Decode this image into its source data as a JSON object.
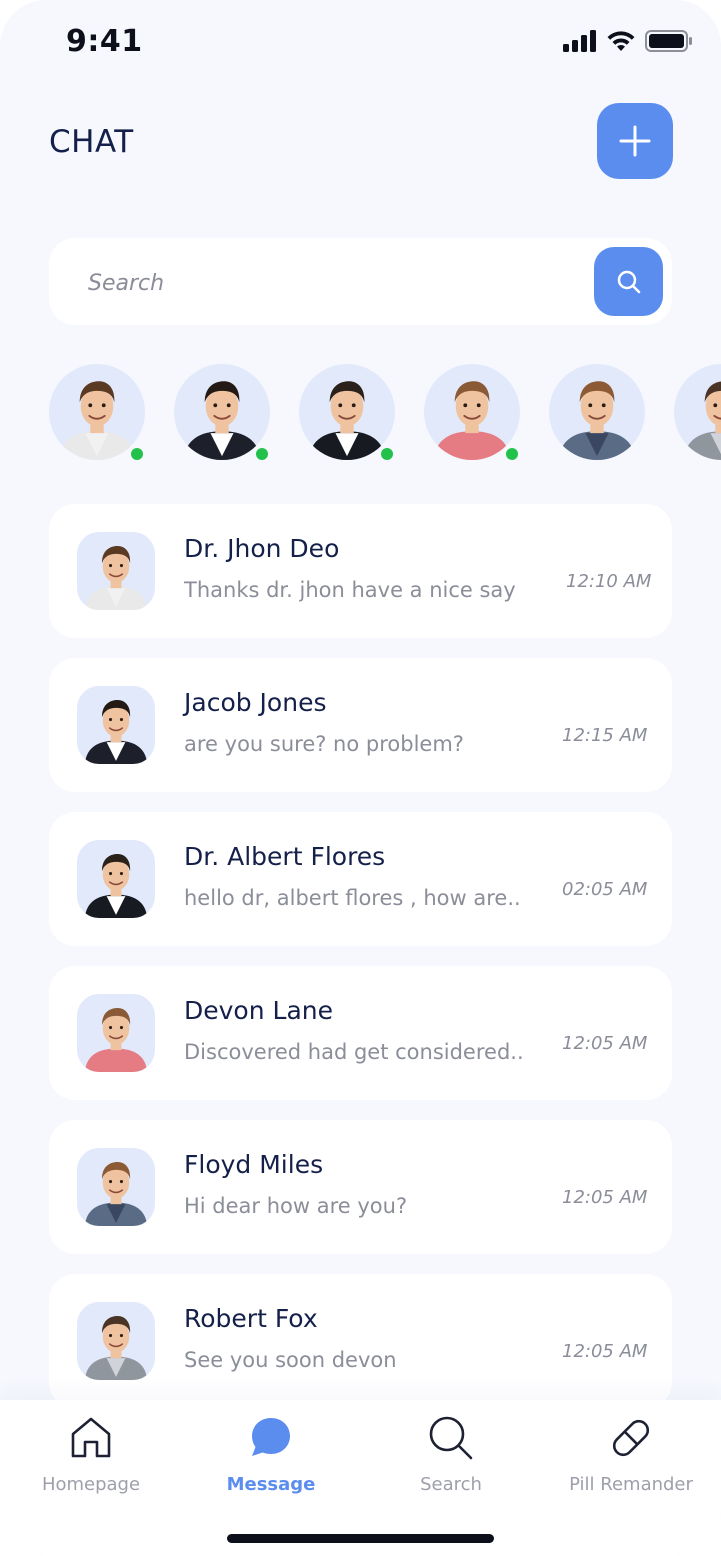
{
  "status_bar": {
    "time": "9:41"
  },
  "header": {
    "title": "CHAT"
  },
  "search": {
    "placeholder": "Search"
  },
  "stories": [
    {
      "name": "Dr. Jhon Deo",
      "online": true,
      "shirt": "#f1f1f1",
      "jacket": "#e9e9e9",
      "hair": "#5b3a24"
    },
    {
      "name": "Jacob Jones",
      "online": true,
      "shirt": "#ffffff",
      "jacket": "#1d1f2a",
      "hair": "#231a15"
    },
    {
      "name": "Dr. Albert Flores",
      "online": true,
      "shirt": "#ffffff",
      "jacket": "#181a22",
      "hair": "#2b211b"
    },
    {
      "name": "Devon Lane",
      "online": true,
      "shirt": "#e57c84",
      "jacket": "#e57c84",
      "hair": "#8a5a36"
    },
    {
      "name": "Floyd Miles",
      "online": false,
      "shirt": "#3b4660",
      "jacket": "#5a6b85",
      "hair": "#8c5a34"
    },
    {
      "name": "Robert Fox",
      "online": false,
      "shirt": "#d0d4da",
      "jacket": "#8f969e",
      "hair": "#4a3426"
    }
  ],
  "chats": [
    {
      "name": "Dr. Jhon Deo",
      "message": "Thanks dr. jhon have a nice say",
      "time": "12:10 AM"
    },
    {
      "name": "Jacob Jones",
      "message": "are you sure? no problem?",
      "time": "12:15 AM"
    },
    {
      "name": "Dr. Albert Flores",
      "message": "hello dr, albert flores , how are..",
      "time": "02:05 AM"
    },
    {
      "name": "Devon Lane",
      "message": "Discovered had get considered..",
      "time": "12:05 AM"
    },
    {
      "name": "Floyd Miles",
      "message": "Hi dear how are you?",
      "time": "12:05 AM"
    },
    {
      "name": "Robert Fox",
      "message": "See you soon devon",
      "time": "12:05 AM"
    }
  ],
  "nav": {
    "items": [
      {
        "label": "Homepage",
        "icon": "home-icon",
        "active": false
      },
      {
        "label": "Message",
        "icon": "chat-bubble-icon",
        "active": true
      },
      {
        "label": "Search",
        "icon": "search-icon",
        "active": false
      },
      {
        "label": "Pill Remander",
        "icon": "pill-icon",
        "active": false
      }
    ]
  },
  "colors": {
    "accent": "#5b8def",
    "background": "#f6f8fe",
    "online": "#22c24a",
    "title": "#15204a"
  }
}
